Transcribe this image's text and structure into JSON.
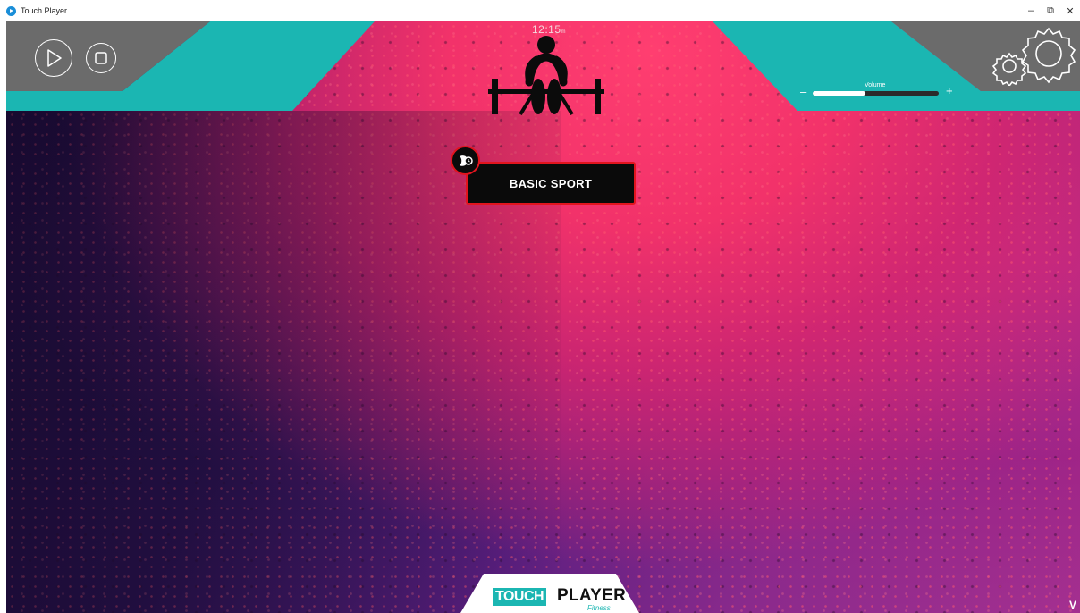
{
  "window": {
    "title": "Touch Player",
    "controls": [
      "minimize",
      "restore",
      "close"
    ],
    "minimize_glyph": "–",
    "restore_glyph": "⧉",
    "close_glyph": "✕"
  },
  "header": {
    "time": "12:15",
    "time_suffix": "m",
    "icons": [
      "play-icon",
      "stop-icon",
      "weightlifter-icon",
      "settings-gear-icon"
    ]
  },
  "volume": {
    "label": "Volume",
    "minus": "–",
    "plus": "+",
    "level_fraction": 0.42
  },
  "workout": {
    "label": "BASIC SPORT",
    "badge_icon": "timer-badge-icon"
  },
  "logo": {
    "part1": "TOUCH",
    "part2": "PLAYER",
    "tagline": "Fitness"
  },
  "corner_text": "V",
  "colors": {
    "teal": "#1bb6b2",
    "gray": "#6b6b6b",
    "accent_red": "#e2141e",
    "button_bg": "#0a0a0a"
  }
}
